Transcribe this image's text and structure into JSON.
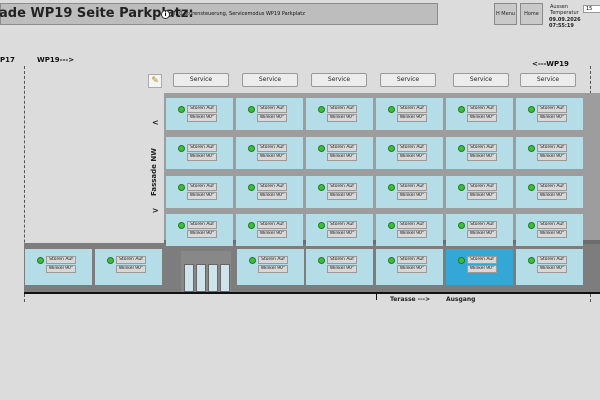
{
  "header": {
    "title": "ade WP19 Seite Parkplatz:",
    "status_icon": "info-icon",
    "status_text": "T10 Storensteuerung, Servicemodus WP19 Parkplatz",
    "nav_button_label": "H Menu",
    "home_button_label": "Home",
    "temp_label_line1": "Aussen",
    "temp_label_line2": "Temperatur",
    "temp_value": "15",
    "datetime": "09.09.2026 07:55:19"
  },
  "markers": {
    "left": "P17",
    "wp19_right_arrow": "WP19--->",
    "wp19_left_arrow": "<---WP19"
  },
  "facade_label": "Fassade NW",
  "service_label": "Service",
  "cell": {
    "line1": "Storen Auf",
    "line2": "Winkel 90°",
    "icon": "check-circle-icon"
  },
  "upper_rows": 4,
  "upper_cols": 6,
  "ground_row_count": 8,
  "ground_highlight_index": 5,
  "bottom": {
    "terrasse": "Terasse --->",
    "ausgang": "Ausgang"
  },
  "chevron_up": ">",
  "chevron_down": "<"
}
